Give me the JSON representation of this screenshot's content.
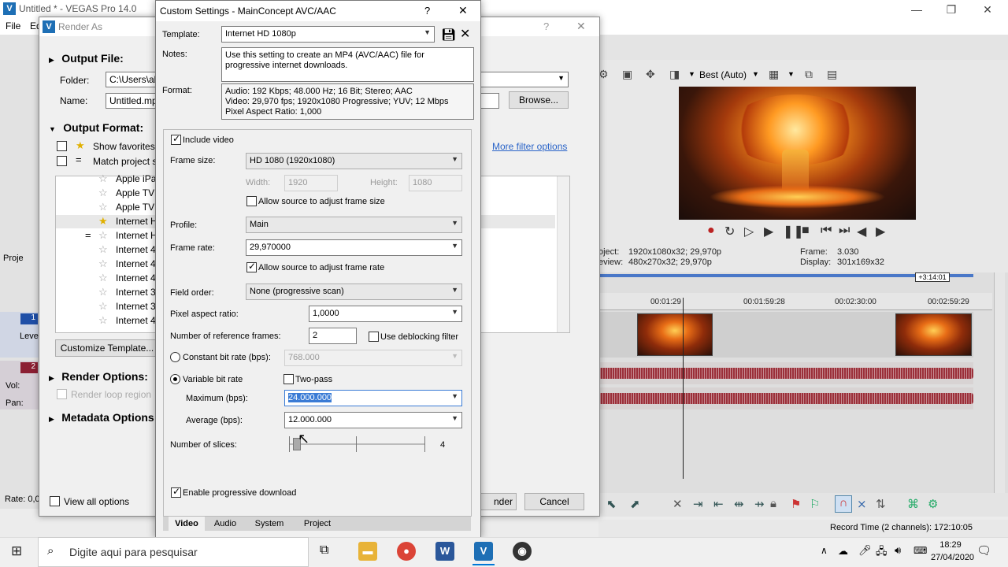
{
  "vegas": {
    "title": "Untitled * - VEGAS Pro 14.0",
    "menu": [
      "File",
      "Ed"
    ],
    "quality": "Best (Auto)",
    "project_label": "oject:",
    "project_value": "1920x1080x32; 29,970p",
    "preview_label": "eview:",
    "preview_value": "480x270x32; 29,970p",
    "frame_label": "Frame:",
    "frame_value": "3.030",
    "display_label": "Display:",
    "display_value": "301x169x32",
    "time_badge": "+3:14:01",
    "ruler": [
      "00:01:29",
      "00:01:59:28",
      "00:02:30:00",
      "00:02:59:29"
    ],
    "record_time": "Record Time (2 channels): 172:10:05",
    "left_track_labels": {
      "leve": "Leve",
      "vol": "Vol:",
      "pan": "Pan:",
      "rate": "Rate: 0,0",
      "proj": "Proje",
      "track1": "1",
      "track2": "2"
    }
  },
  "render_as": {
    "title": "Render As",
    "output_file": "Output File:",
    "folder_label": "Folder:",
    "folder_value": "C:\\Users\\ali",
    "name_label": "Name:",
    "name_value": "Untitled.mp",
    "browse": "Browse...",
    "output_format": "Output Format:",
    "show_favorites": "Show favorites",
    "match_project": "Match project s",
    "more_filter": "More filter options",
    "list": [
      "Apple iPa",
      "Apple TV",
      "Apple TV",
      "Internet H",
      "Internet H",
      "Internet 4",
      "Internet 4",
      "Internet 4",
      "Internet 3",
      "Internet 3",
      "Internet 4"
    ],
    "customize": "Customize Template...",
    "render_options": "Render Options:",
    "render_loop": "Render loop region",
    "metadata_options": "Metadata Options",
    "view_all": "View all options",
    "render_btn": "nder",
    "cancel_btn": "Cancel"
  },
  "custom_settings": {
    "title": "Custom Settings - MainConcept AVC/AAC",
    "help": "?",
    "close": "✕",
    "template_label": "Template:",
    "template_value": "Internet HD 1080p",
    "notes_label": "Notes:",
    "notes_value": "Use this setting to create an MP4 (AVC/AAC) file for progressive internet downloads.",
    "format_label": "Format:",
    "format_line1": "Audio: 192 Kbps; 48.000 Hz; 16 Bit; Stereo; AAC",
    "format_line2": "Video: 29,970 fps; 1920x1080 Progressive; YUV; 12 Mbps",
    "format_line3": "Pixel Aspect Ratio: 1,000",
    "include_video": "Include video",
    "frame_size_label": "Frame size:",
    "frame_size_value": "HD 1080 (1920x1080)",
    "width_label": "Width:",
    "width_value": "1920",
    "height_label": "Height:",
    "height_value": "1080",
    "allow_frame_size": "Allow source to adjust frame size",
    "profile_label": "Profile:",
    "profile_value": "Main",
    "frame_rate_label": "Frame rate:",
    "frame_rate_value": "29,970000",
    "allow_frame_rate": "Allow source to adjust frame rate",
    "field_order_label": "Field order:",
    "field_order_value": "None (progressive scan)",
    "par_label": "Pixel aspect ratio:",
    "par_value": "1,0000",
    "ref_frames_label": "Number of reference frames:",
    "ref_frames_value": "2",
    "deblocking": "Use deblocking filter",
    "cbr_label": "Constant bit rate (bps):",
    "cbr_value": "768.000",
    "vbr_label": "Variable bit rate",
    "two_pass": "Two-pass",
    "max_label": "Maximum (bps):",
    "max_value": "24.000.000",
    "avg_label": "Average (bps):",
    "avg_value": "12.000.000",
    "slices_label": "Number of slices:",
    "slices_value": "4",
    "slices_fraction": 0.05,
    "progressive_download": "Enable progressive download",
    "tabs": [
      "Video",
      "Audio",
      "System",
      "Project"
    ]
  },
  "taskbar": {
    "search_placeholder": "Digite aqui para pesquisar",
    "time": "18:29",
    "date": "27/04/2020"
  }
}
